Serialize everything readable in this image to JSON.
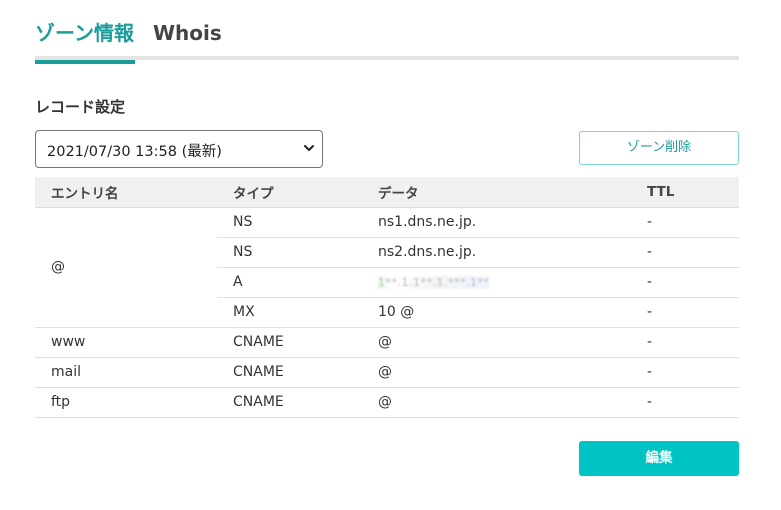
{
  "tabs": {
    "zone_info": "ゾーン情報",
    "whois": "Whois"
  },
  "section": {
    "title": "レコード設定"
  },
  "version_select": {
    "selected": "2021/07/30 13:58 (最新)"
  },
  "buttons": {
    "delete_zone": "ゾーン削除",
    "edit": "編集"
  },
  "table": {
    "headers": {
      "entry": "エントリ名",
      "type": "タイプ",
      "data": "データ",
      "ttl": "TTL"
    },
    "groups": [
      {
        "entry": "@",
        "rows": [
          {
            "type": "NS",
            "data": "ns1.dns.ne.jp.",
            "ttl": "-"
          },
          {
            "type": "NS",
            "data": "ns2.dns.ne.jp.",
            "ttl": "-"
          },
          {
            "type": "A",
            "data": "1**.1.1**.1.***.1**",
            "ttl": "-"
          },
          {
            "type": "MX",
            "data": "10 @",
            "ttl": "-"
          }
        ]
      },
      {
        "entry": "www",
        "rows": [
          {
            "type": "CNAME",
            "data": "@",
            "ttl": "-"
          }
        ]
      },
      {
        "entry": "mail",
        "rows": [
          {
            "type": "CNAME",
            "data": "@",
            "ttl": "-"
          }
        ]
      },
      {
        "entry": "ftp",
        "rows": [
          {
            "type": "CNAME",
            "data": "@",
            "ttl": "-"
          }
        ]
      }
    ]
  },
  "colors": {
    "accent": "#1a9e9b",
    "edit_button": "#00c4c4",
    "header_bg": "#f0f0f2"
  }
}
